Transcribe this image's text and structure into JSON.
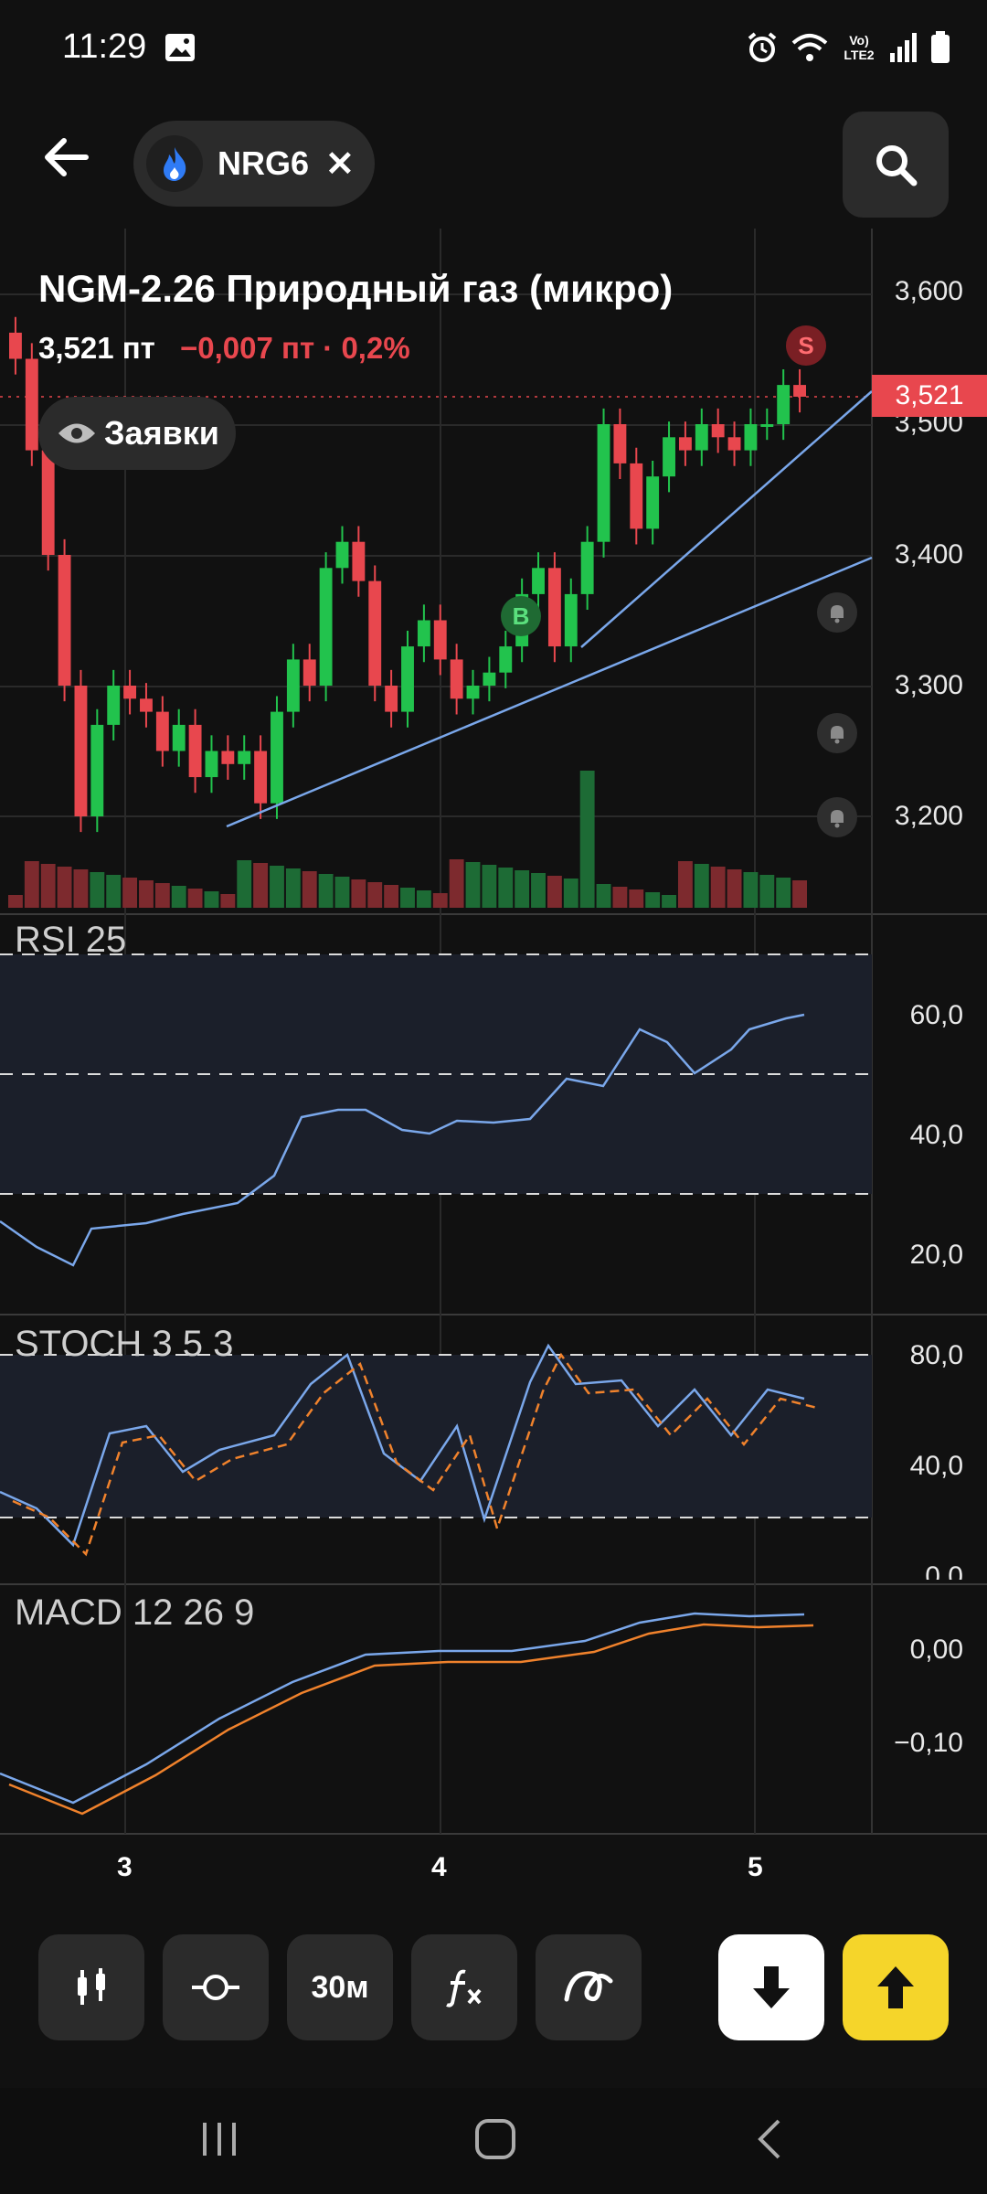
{
  "status": {
    "time": "11:29",
    "network": "Vo) LTE2"
  },
  "header": {
    "ticker": "NRG6",
    "ticker_logo": "flame-icon"
  },
  "instrument": {
    "title": "NGM-2.26 Природный газ (микро)",
    "price": "3,521 пт",
    "change": "−0,007 пт · 0,2%",
    "orders_label": "Заявки",
    "current_price_tag": "3,521"
  },
  "colors": {
    "up": "#22c34d",
    "down": "#e8474e",
    "accent": "#f5d52a",
    "line_blue": "#7aa7ea",
    "line_orange": "#f0822c"
  },
  "price_axis": {
    "labels": [
      "3,600",
      "3,500",
      "3,400",
      "3,300",
      "3,200"
    ]
  },
  "markers": {
    "buy": "B",
    "sell": "S"
  },
  "indicators": {
    "rsi": {
      "title": "RSI 25",
      "labels": [
        "60,0",
        "40,0",
        "20,0"
      ]
    },
    "stoch": {
      "title": "STOCH 3 5 3",
      "labels": [
        "80,0",
        "40,0",
        "0,0"
      ]
    },
    "macd": {
      "title": "MACD 12 26 9",
      "labels": [
        "0,00",
        "−0,10"
      ]
    }
  },
  "time_axis": {
    "labels": [
      "3",
      "4",
      "5"
    ]
  },
  "toolbar": {
    "chart_type_icon": "candles-icon",
    "indicator_icon": "line-point-icon",
    "interval": "30м",
    "functions_icon": "fx-icon",
    "draw_icon": "draw-curve-icon",
    "sell_icon": "arrow-down-icon",
    "buy_icon": "arrow-up-icon"
  },
  "chart_data": {
    "type": "candlestick",
    "price_range": [
      3.19,
      3.62
    ],
    "last_price": 3.521,
    "ohlc_approx_close": [
      3.55,
      3.48,
      3.4,
      3.3,
      3.2,
      3.27,
      3.3,
      3.29,
      3.28,
      3.25,
      3.27,
      3.23,
      3.25,
      3.24,
      3.25,
      3.21,
      3.28,
      3.32,
      3.3,
      3.39,
      3.41,
      3.38,
      3.3,
      3.28,
      3.33,
      3.35,
      3.32,
      3.29,
      3.3,
      3.31,
      3.33,
      3.37,
      3.39,
      3.33,
      3.37,
      3.41,
      3.5,
      3.47,
      3.42,
      3.46,
      3.49,
      3.48,
      3.5,
      3.49,
      3.48,
      3.5,
      3.5,
      3.53,
      3.521
    ],
    "rsi": {
      "levels": [
        70,
        50,
        30
      ],
      "range": [
        10,
        70
      ]
    },
    "stoch": {
      "levels": [
        80,
        20
      ],
      "range": [
        0,
        100
      ]
    },
    "macd": {
      "range": [
        -0.2,
        0.05
      ]
    },
    "x_labels": [
      "3",
      "4",
      "5"
    ]
  }
}
